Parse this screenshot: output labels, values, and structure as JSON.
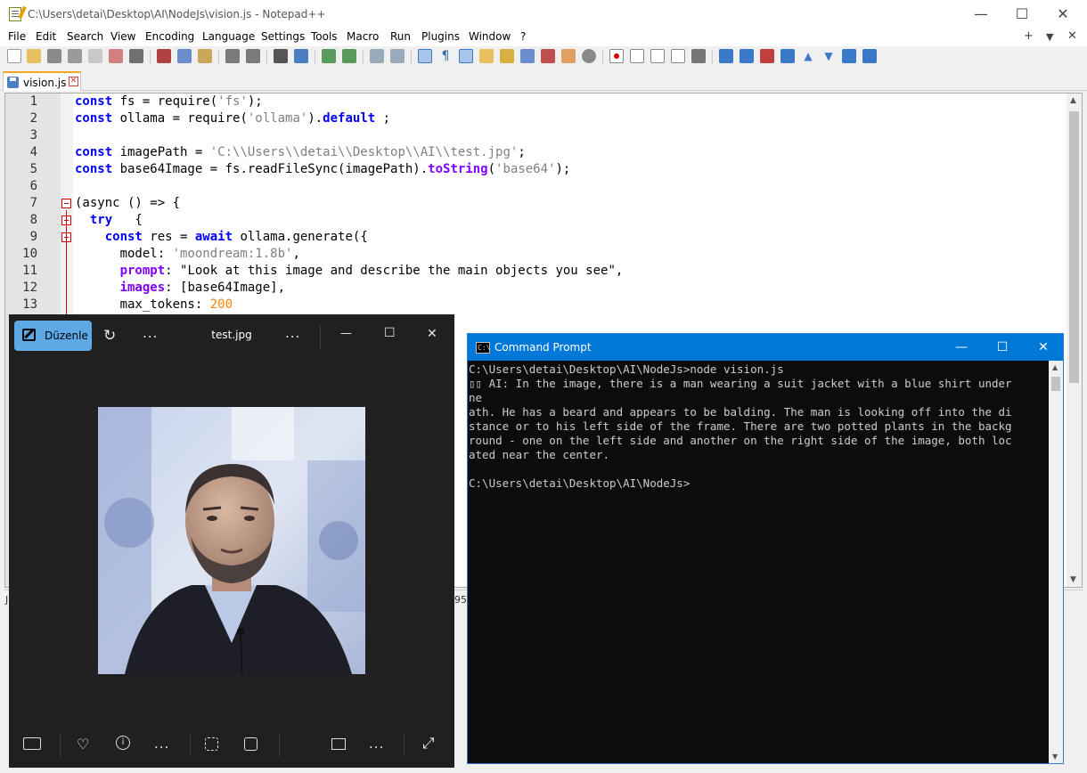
{
  "notepad": {
    "title": "C:\\Users\\detai\\Desktop\\AI\\NodeJs\\vision.js - Notepad++",
    "menu": [
      "File",
      "Edit",
      "Search",
      "View",
      "Encoding",
      "Language",
      "Settings",
      "Tools",
      "Macro",
      "Run",
      "Plugins",
      "Window",
      "?"
    ],
    "menu_right": {
      "plus": "+",
      "dropdown": "▼",
      "close": "✕"
    },
    "tab": {
      "name": "vision.js",
      "close": "✕"
    },
    "code_lines": [
      {
        "n": "1",
        "segs": [
          [
            "kw",
            "const"
          ],
          [
            "",
            "fs = require("
          ],
          [
            "str",
            "'fs'"
          ],
          [
            "",
            ");"
          ]
        ]
      },
      {
        "n": "2",
        "segs": [
          [
            "kw",
            "const"
          ],
          [
            "",
            "ollama = require("
          ],
          [
            "str",
            "'ollama'"
          ],
          [
            "",
            ")."
          ],
          [
            "kw",
            "default"
          ],
          [
            "",
            ";"
          ]
        ]
      },
      {
        "n": "3",
        "segs": []
      },
      {
        "n": "4",
        "segs": [
          [
            "kw",
            "const"
          ],
          [
            "",
            "imagePath = "
          ],
          [
            "str",
            "'C:\\\\Users\\\\detai\\\\Desktop\\\\AI\\\\test.jpg'"
          ],
          [
            "",
            ";"
          ]
        ]
      },
      {
        "n": "5",
        "segs": [
          [
            "kw",
            "const"
          ],
          [
            "",
            "base64Image = fs.readFileSync(imagePath)."
          ],
          [
            "prop",
            "toString"
          ],
          [
            "",
            "("
          ],
          [
            "str",
            "'base64'"
          ],
          [
            "",
            ");"
          ]
        ]
      },
      {
        "n": "6",
        "segs": []
      },
      {
        "n": "7",
        "segs": [
          [
            "",
            "(async () => {"
          ]
        ]
      },
      {
        "n": "8",
        "segs": [
          [
            "",
            "  "
          ],
          [
            "kw",
            "try"
          ],
          [
            "",
            "  {"
          ]
        ]
      },
      {
        "n": "9",
        "segs": [
          [
            "",
            "    "
          ],
          [
            "kw",
            "const"
          ],
          [
            "",
            "res = "
          ],
          [
            "kw",
            "await"
          ],
          [
            "",
            "ollama.generate({"
          ]
        ]
      },
      {
        "n": "10",
        "segs": [
          [
            "",
            "      model: "
          ],
          [
            "str",
            "'moondream:1.8b'"
          ],
          [
            "",
            ","
          ]
        ]
      },
      {
        "n": "11",
        "segs": [
          [
            "",
            "      "
          ],
          [
            "prop",
            "prompt"
          ],
          [
            "",
            ": \"Look at this image and describe the main objects you see\","
          ]
        ]
      },
      {
        "n": "12",
        "segs": [
          [
            "",
            "      "
          ],
          [
            "prop",
            "images"
          ],
          [
            "",
            ": [base64Image],"
          ]
        ]
      },
      {
        "n": "13",
        "segs": [
          [
            "",
            "      max_tokens: "
          ],
          [
            "num",
            "200"
          ]
        ]
      }
    ],
    "status_left": "J",
    "status_mid": "95"
  },
  "photos": {
    "edit_label": "Düzenle",
    "file_name": "test.jpg",
    "more_label": "...",
    "controls": {
      "min": "—",
      "max": "☐",
      "close": "✕"
    },
    "bottom_more": "..."
  },
  "cmd": {
    "title": "Command Prompt",
    "icon_text": "C:\\",
    "lines": [
      "C:\\Users\\detai\\Desktop\\AI\\NodeJs>node vision.js",
      "▯▯ AI: In the image, there is a man wearing a suit jacket with a blue shirt under",
      "ne",
      "ath. He has a beard and appears to be balding. The man is looking off into the di",
      "stance or to his left side of the frame. There are two potted plants in the backg",
      "round - one on the left side and another on the right side of the image, both loc",
      "ated near the center.",
      "",
      "C:\\Users\\detai\\Desktop\\AI\\NodeJs>"
    ]
  },
  "colors": {
    "cmd_title_bg": "#0078d7",
    "photos_edit_accent": "#5ca9e6",
    "npp_keyword": "#0000ff",
    "npp_string": "#808080",
    "npp_number": "#ff8000"
  }
}
